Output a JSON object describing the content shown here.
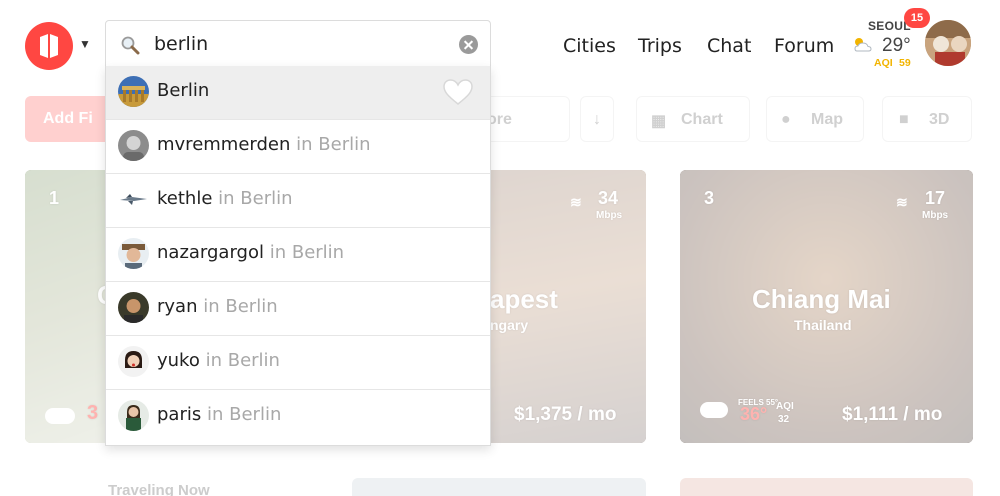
{
  "header": {
    "nav": [
      "Cities",
      "Trips",
      "Chat",
      "Forum"
    ],
    "weather": {
      "city": "SEOUL",
      "temp": "29°",
      "aqi_label": "AQI",
      "aqi_value": "59",
      "icon": "partly-cloudy-icon"
    },
    "notifications": "15"
  },
  "search": {
    "value": "berlin",
    "icon": "search-icon",
    "results": [
      {
        "name": "Berlin",
        "location": "",
        "favorite_icon": "heart-icon"
      },
      {
        "name": "mvremmerden",
        "location": "in Berlin"
      },
      {
        "name": "kethle",
        "location": "in Berlin"
      },
      {
        "name": "nazargargol",
        "location": "in Berlin"
      },
      {
        "name": "ryan",
        "location": "in Berlin"
      },
      {
        "name": "yuko",
        "location": "in Berlin"
      },
      {
        "name": "paris",
        "location": "in Berlin"
      }
    ]
  },
  "toolbar": {
    "add_label": "Add Fi",
    "sort_label": "ore",
    "sort_icon": "arrow-down-icon",
    "chart_label": "Chart",
    "map_label": "Map",
    "threed_label": "3D"
  },
  "cards": [
    {
      "rank": "1",
      "name": "C",
      "country": "",
      "price": "",
      "temp": "3"
    },
    {
      "rank": "",
      "name": "apest",
      "country": "ngary",
      "wifi": "34",
      "wifi_unit": "Mbps",
      "price": "$1,375 / mo"
    },
    {
      "rank": "3",
      "name": "Chiang Mai",
      "country": "Thailand",
      "wifi": "17",
      "wifi_unit": "Mbps",
      "feels_label": "FEELS 55°",
      "temp": "36°",
      "aqi_label": "AQI",
      "aqi": "32",
      "price": "$1,111 / mo"
    }
  ],
  "traveling_now": "Traveling Now",
  "colors": {
    "brand": "#ff4742",
    "aqi": "#f2b400"
  }
}
